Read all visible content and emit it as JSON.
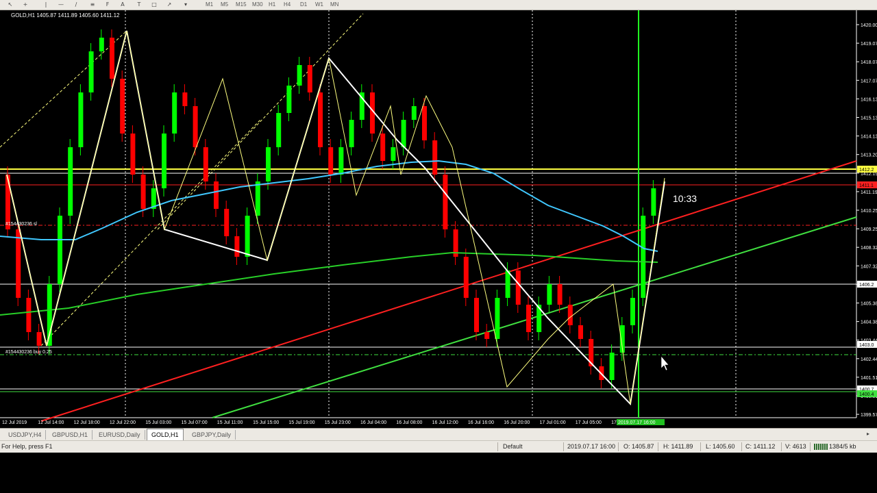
{
  "toolbar": {
    "icons": [
      "cursor-icon",
      "crosshair-icon",
      "vertical-line-icon",
      "horizontal-line-icon",
      "trendline-icon",
      "channel-icon",
      "fibonacci-icon",
      "text-icon",
      "label-icon",
      "shapes-icon",
      "arrow-icon"
    ],
    "timeframes": [
      "M1",
      "M5",
      "M15",
      "M30",
      "H1",
      "H4",
      "D1",
      "W1",
      "MN"
    ]
  },
  "chart": {
    "symbol_info": "GOLD,H1  1405.87 1411.89 1405.60 1411.12",
    "countdown": "10:33",
    "order_label_top": "#154430236 sl",
    "order_label_bottom": "#154430236 buy 0.25",
    "y_axis": [
      "1420.00",
      "1419.07",
      "1418.07",
      "1417.07",
      "1416.13",
      "1415.13",
      "1414.13",
      "1413.20",
      "1412.19",
      "1411.19",
      "1410.25",
      "1409.25",
      "1408.32",
      "1407.32",
      "1406.32",
      "1405.38",
      "1404.38",
      "1403.44",
      "1402.44",
      "1401.51",
      "1400.51",
      "1399.57"
    ],
    "price_tags": [
      "1412.2",
      "1411.1",
      "1406.2",
      "1403.0",
      "1400.7",
      "1400.4"
    ],
    "x_axis": [
      "12 Jul 2019",
      "12 Jul 14:00",
      "12 Jul 18:00",
      "12 Jul 22:00",
      "15 Jul 03:00",
      "15 Jul 07:00",
      "15 Jul 11:00",
      "15 Jul 15:00",
      "15 Jul 19:00",
      "15 Jul 23:00",
      "16 Jul 04:00",
      "16 Jul 08:00",
      "16 Jul 12:00",
      "16 Jul 16:00",
      "16 Jul 20:00",
      "17 Jul 01:00",
      "17 Jul 05:00",
      "17 Jul"
    ],
    "x_highlight": "2019.07.17 16:00",
    "colors": {
      "bull": "#00ff00",
      "bear": "#ff0000",
      "ma_fast": "#40c8ff",
      "ma_slow": "#28d028",
      "zigzag": "#ffffff",
      "zigzag2": "#ffff80",
      "trend_red": "#ff2020",
      "trend_green": "#40e040",
      "hline_yellow": "#ffff40"
    }
  },
  "tabs": [
    "USDJPY,H4",
    "GBPUSD,H1",
    "EURUSD,Daily",
    "GOLD,H1",
    "GBPJPY,Daily"
  ],
  "active_tab": "GOLD,H1",
  "status": {
    "help": "For Help, press F1",
    "profile": "Default",
    "time": "2019.07.17 16:00",
    "open": "O: 1405.87",
    "high": "H: 1411.89",
    "low": "L: 1405.60",
    "close": "C: 1411.12",
    "volume": "V: 4613",
    "traffic": "1384/5 kb"
  }
}
